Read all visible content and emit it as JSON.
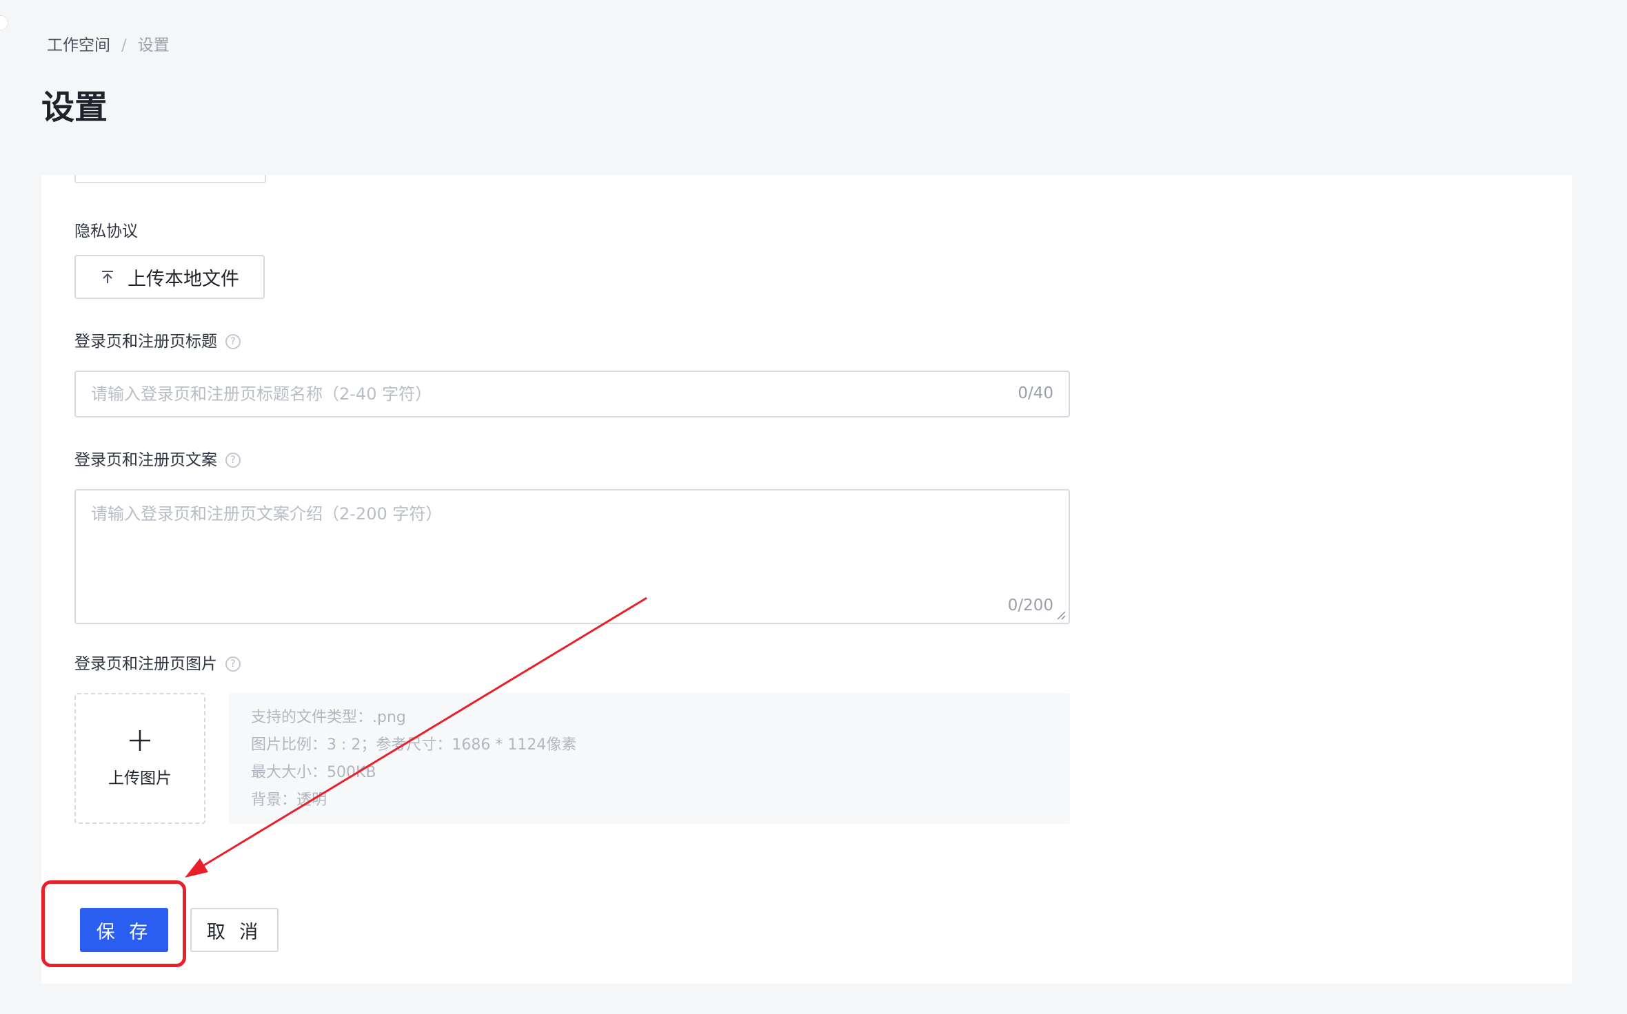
{
  "breadcrumb": {
    "items": [
      "工作空间",
      "设置"
    ],
    "separator": "/"
  },
  "page": {
    "title": "设置"
  },
  "form": {
    "privacy": {
      "label": "隐私协议",
      "upload_label": "上传本地文件"
    },
    "login_title": {
      "label": "登录页和注册页标题",
      "placeholder": "请输入登录页和注册页标题名称（2-40 字符）",
      "value": "",
      "counter": "0/40"
    },
    "login_copy": {
      "label": "登录页和注册页文案",
      "placeholder": "请输入登录页和注册页文案介绍（2-200 字符）",
      "value": "",
      "counter": "0/200"
    },
    "login_image": {
      "label": "登录页和注册页图片",
      "upload_label": "上传图片",
      "hints": [
        "支持的文件类型：.png",
        "图片比例：3 : 2；参考尺寸：1686 * 1124像素",
        "最大大小：500KB",
        "背景：透明"
      ]
    }
  },
  "actions": {
    "save_label": "保 存",
    "cancel_label": "取 消"
  },
  "colors": {
    "primary": "#2a5ef0",
    "annotation": "#e8202a",
    "background": "#f5f6f8"
  }
}
